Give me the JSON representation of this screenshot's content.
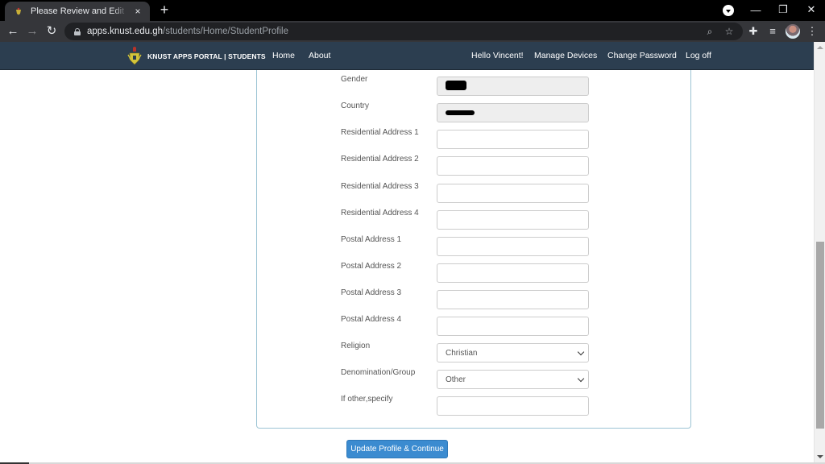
{
  "browser": {
    "tab_title": "Please Review and Edit your Personal Details",
    "tab_close_icon": "×",
    "new_tab_icon": "+",
    "url_host": "apps.knust.edu.gh",
    "url_path": "/students/Home/StudentProfile",
    "back_icon": "←",
    "forward_icon": "→",
    "reload_icon": "↻",
    "zoom_icon": "⌕",
    "bookmark_icon": "☆",
    "extensions_icon": "✚",
    "media_icon": "≡",
    "menu_icon": "⋮",
    "minimize_icon": "—",
    "restore_icon": "❐",
    "close_window_icon": "✕"
  },
  "navbar": {
    "brand": "KNUST APPS PORTAL | STUDENTS",
    "links": [
      "Home",
      "About"
    ],
    "right_links": [
      "Hello Vincent!",
      "Manage Devices",
      "Change Password",
      "Log off"
    ]
  },
  "form": {
    "fields": [
      {
        "label": "Gender",
        "value": "[redacted]",
        "readonly": true
      },
      {
        "label": "Country",
        "value": "[redacted]",
        "readonly": true
      },
      {
        "label": "Residential Address 1",
        "value": ""
      },
      {
        "label": "Residential Address 2",
        "value": ""
      },
      {
        "label": "Residential Address 3",
        "value": ""
      },
      {
        "label": "Residential Address 4",
        "value": ""
      },
      {
        "label": "Postal Address 1",
        "value": ""
      },
      {
        "label": "Postal Address 2",
        "value": ""
      },
      {
        "label": "Postal Address 3",
        "value": ""
      },
      {
        "label": "Postal Address 4",
        "value": ""
      }
    ],
    "religion": {
      "label": "Religion",
      "selected": "Christian"
    },
    "denomination": {
      "label": "Denomination/Group",
      "selected": "Other"
    },
    "other_specify": {
      "label": "If other,specify",
      "value": ""
    },
    "submit_label": "Update Profile & Continue"
  },
  "colors": {
    "navbar_bg": "#2c3e50",
    "panel_border": "#9cc4d4",
    "button_primary": "#3b8bd0"
  }
}
